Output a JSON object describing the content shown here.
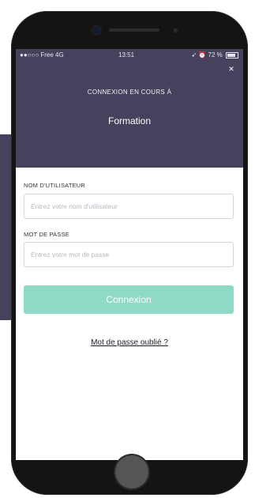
{
  "status_bar": {
    "carrier": "●●○○○ Free 4G",
    "time": "13:51",
    "battery": "72 %",
    "indicators": "➶ ⏰"
  },
  "header": {
    "connecting_label": "CONNEXION EN COURS À",
    "organization": "Formation",
    "close_icon": "×"
  },
  "form": {
    "username_label": "NOM D'UTILISATEUR",
    "username_value": "",
    "username_placeholder": "Entrez votre nom d'utilisateur",
    "password_label": "MOT DE PASSE",
    "password_value": "",
    "password_placeholder": "Entrez votre mot de passe",
    "submit_label": "Connexion",
    "forgot_password_link": "Mot de passe oublié ?"
  },
  "colors": {
    "header_bg": "#46415c",
    "button_bg": "#8fd9c7",
    "phone_frame": "#141414"
  }
}
